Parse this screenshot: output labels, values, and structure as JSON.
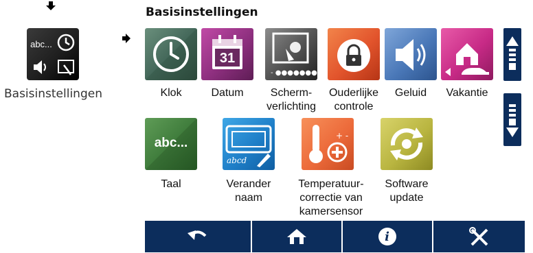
{
  "header": {
    "title": "Basisinstellingen"
  },
  "sidebar": {
    "caption": "Basisinstellingen",
    "thumb_text": "abc..."
  },
  "tiles": [
    {
      "label": "Klok",
      "icon": "clock-icon"
    },
    {
      "label": "Datum",
      "icon": "calendar-icon",
      "day": "31"
    },
    {
      "label": "Scherm-\nverlichting",
      "icon": "screen-brightness-icon"
    },
    {
      "label": "Ouderlijke\ncontrole",
      "icon": "padlock-icon"
    },
    {
      "label": "Geluid",
      "icon": "speaker-icon"
    },
    {
      "label": "Vakantie",
      "icon": "holiday-icon"
    },
    {
      "label": "Taal",
      "icon": "language-icon",
      "text": "abc..."
    },
    {
      "label": "Verander\nnaam",
      "icon": "rename-icon",
      "text": "abcd"
    },
    {
      "label": "Temperatuur-\ncorrectie van\nkamersensor",
      "icon": "thermometer-icon"
    },
    {
      "label": "Software\nupdate",
      "icon": "software-update-icon"
    }
  ],
  "scroll": {
    "up_icon": "scroll-up-icon",
    "down_icon": "scroll-down-icon"
  },
  "bottom_bar": [
    {
      "name": "back-button",
      "icon": "back-arrow-icon"
    },
    {
      "name": "home-button",
      "icon": "home-icon"
    },
    {
      "name": "info-button",
      "icon": "info-icon",
      "glyph": "i"
    },
    {
      "name": "tools-button",
      "icon": "tools-icon"
    }
  ],
  "colors": {
    "navy": "#0c2d5c",
    "accent_red": "#c8102e"
  }
}
